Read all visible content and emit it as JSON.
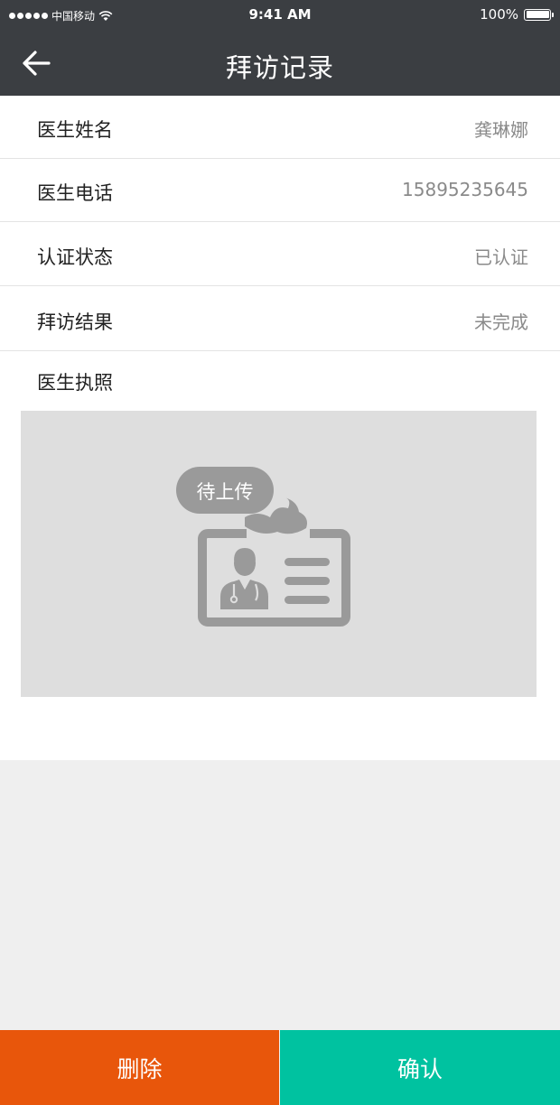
{
  "status_bar": {
    "carrier": "中国移动",
    "time": "9:41 AM",
    "battery": "100%"
  },
  "nav": {
    "title": "拜访记录",
    "back_icon": "back-arrow-icon"
  },
  "fields": [
    {
      "label": "医生姓名",
      "value": "龚琳娜"
    },
    {
      "label": "医生电话",
      "value": "15895235645"
    },
    {
      "label": "认证状态",
      "value": "已认证"
    },
    {
      "label": "拜访结果",
      "value": "未完成"
    }
  ],
  "license": {
    "label": "医生执照",
    "placeholder_badge": "待上传",
    "icon": "doctor-id-card-icon"
  },
  "actions": {
    "delete_label": "删除",
    "confirm_label": "确认"
  },
  "colors": {
    "header_bg": "#3b3e42",
    "delete_bg": "#e8560b",
    "confirm_bg": "#00c2a0",
    "placeholder_bg": "#dedede",
    "icon_gray": "#9a9a9a"
  }
}
